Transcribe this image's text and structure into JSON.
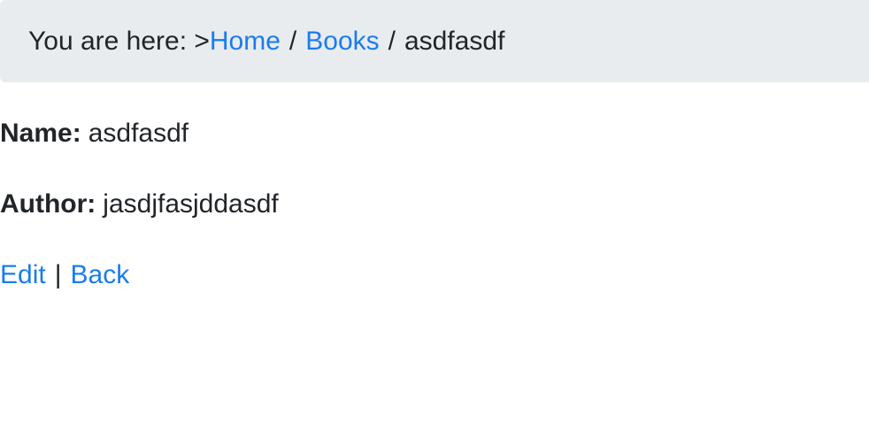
{
  "breadcrumb": {
    "prefix": "You are here: >",
    "items": [
      {
        "label": "Home"
      },
      {
        "label": "Books"
      }
    ],
    "separator": "/",
    "current": "asdfasdf"
  },
  "details": {
    "name_label": "Name:",
    "name_value": "asdfasdf",
    "author_label": "Author:",
    "author_value": "jasdjfasjddasdf"
  },
  "actions": {
    "edit_label": "Edit",
    "pipe": "|",
    "back_label": "Back"
  },
  "colors": {
    "link": "#1a7cf0",
    "breadcrumb_bg": "#e9ecef",
    "text": "#212529"
  }
}
